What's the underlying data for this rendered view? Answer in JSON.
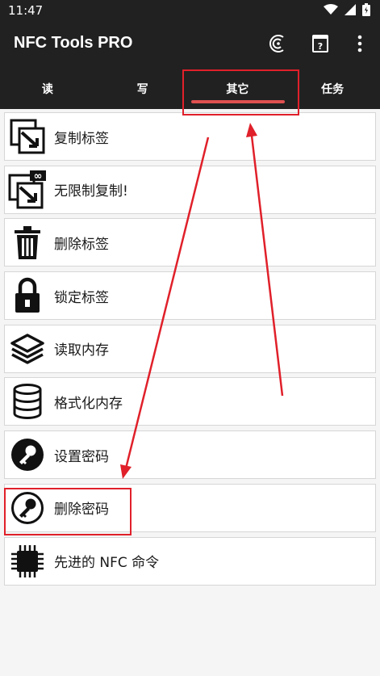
{
  "status_bar": {
    "time": "11:47"
  },
  "app_bar": {
    "title": "NFC Tools PRO"
  },
  "tabs": [
    {
      "label": "读"
    },
    {
      "label": "写"
    },
    {
      "label": "其它"
    },
    {
      "label": "任务"
    }
  ],
  "list": [
    {
      "label": "复制标签",
      "icon": "copy-tag-icon"
    },
    {
      "label": "无限制复制!",
      "icon": "unlimited-copy-icon"
    },
    {
      "label": "删除标签",
      "icon": "trash-icon"
    },
    {
      "label": "锁定标签",
      "icon": "lock-icon"
    },
    {
      "label": "读取内存",
      "icon": "layers-icon"
    },
    {
      "label": "格式化内存",
      "icon": "database-icon"
    },
    {
      "label": "设置密码",
      "icon": "key-icon"
    },
    {
      "label": "删除密码",
      "icon": "key-icon"
    },
    {
      "label": "先进的 NFC 命令",
      "icon": "chip-icon"
    }
  ],
  "colors": {
    "top_bar": "#212121",
    "tab_indicator": "#e05050",
    "annotation": "#e0202a",
    "background": "#f5f5f5"
  }
}
